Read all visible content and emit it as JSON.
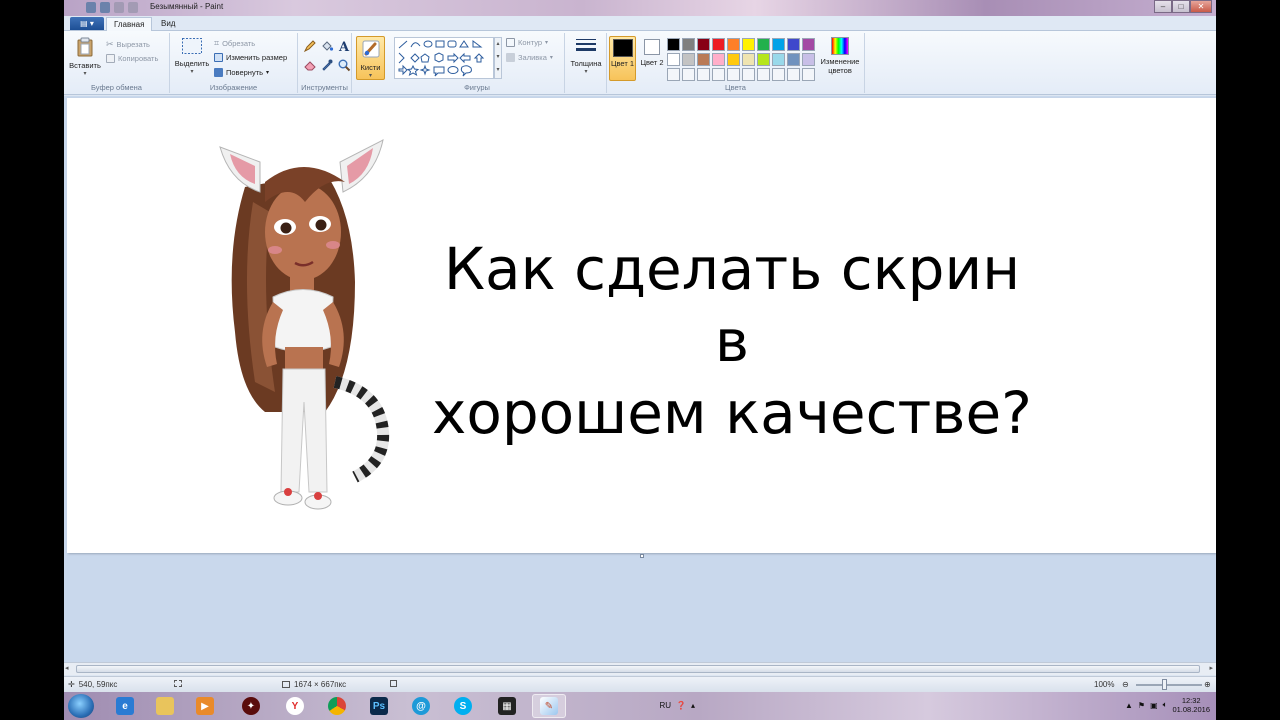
{
  "window": {
    "title": "Безымянный - Paint",
    "buttons": {
      "minimize": "–",
      "maximize": "□",
      "close": "✕"
    }
  },
  "tabs": {
    "file": "▤ ▾",
    "items": [
      {
        "label": "Главная"
      },
      {
        "label": "Вид"
      }
    ]
  },
  "ribbon": {
    "clipboard": {
      "paste": "Вставить",
      "cut": "Вырезать",
      "copy": "Копировать",
      "group": "Буфер обмена"
    },
    "image": {
      "select": "Выделить",
      "crop": "Обрезать",
      "resize": "Изменить размер",
      "rotate": "Повернуть",
      "group": "Изображение"
    },
    "tools": {
      "group": "Инструменты",
      "text_tool": "A"
    },
    "brushes": {
      "label": "Кисти"
    },
    "shapes": {
      "outline": "Контур",
      "fill": "Заливка",
      "group": "Фигуры"
    },
    "size": {
      "label": "Толщина"
    },
    "colors": {
      "color1": "Цвет 1",
      "color2": "Цвет 2",
      "edit": "Изменение цветов",
      "group": "Цвета",
      "palette": [
        "#000000",
        "#7f7f7f",
        "#880015",
        "#ed1c24",
        "#ff7f27",
        "#fff200",
        "#22b14c",
        "#00a2e8",
        "#3f48cc",
        "#a349a4",
        "#ffffff",
        "#c3c3c3",
        "#b97a57",
        "#ffaec9",
        "#ffc90e",
        "#efe4b0",
        "#b5e61d",
        "#99d9ea",
        "#7092be",
        "#c8bfe7"
      ]
    }
  },
  "canvas": {
    "headline_line1": "Как сделать скрин в",
    "headline_line2": "хорошем качестве?"
  },
  "status": {
    "cursor": "540, 59пкс",
    "image_size": "1674 × 667пкс",
    "zoom": "100%"
  },
  "taskbar": {
    "lang": "RU",
    "time": "12:32",
    "date": "01.08.2016"
  }
}
